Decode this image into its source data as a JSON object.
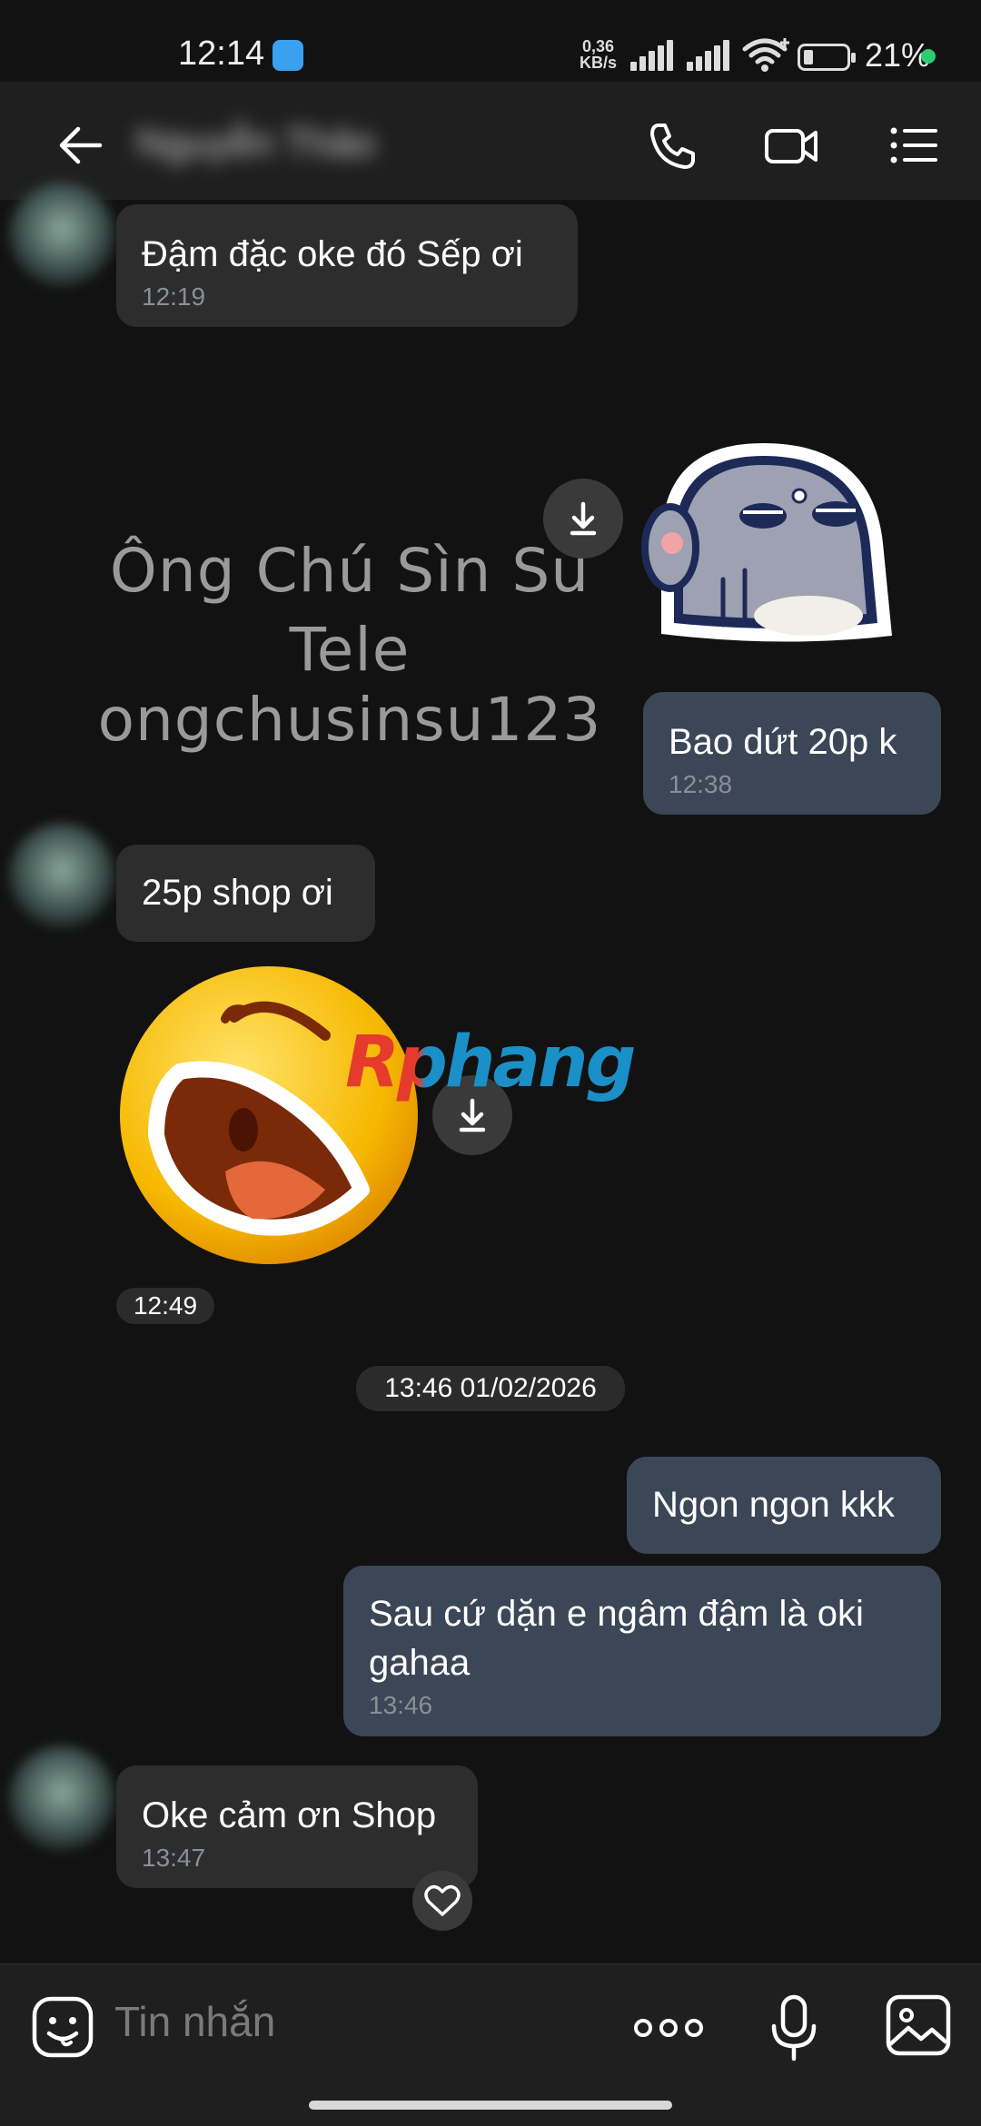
{
  "status_bar": {
    "time": "12:14",
    "net_speed_value": "0,36",
    "net_speed_unit": "KB/s",
    "battery_percent": "21%",
    "indicator_color": "#2ecc71"
  },
  "header": {
    "contact_name": "Nguyễn Thảo",
    "icons": [
      "back-arrow-icon",
      "phone-icon",
      "video-icon",
      "menu-list-icon"
    ]
  },
  "messages": [
    {
      "direction": "in",
      "text": "Đậm đặc oke đó Sếp ơi",
      "time": "12:19"
    },
    {
      "direction": "out",
      "type": "sticker",
      "sticker": "grey-ghost-sticker"
    },
    {
      "direction": "out",
      "text": "Bao dứt 20p k",
      "time": "12:38"
    },
    {
      "direction": "in",
      "text": "25p shop ơi"
    },
    {
      "direction": "in",
      "type": "sticker",
      "sticker": "laughing-emoji-sticker",
      "time": "12:49"
    },
    {
      "direction": "out",
      "text": "Ngon ngon kkk"
    },
    {
      "direction": "out",
      "text": "Sau cứ dặn e ngâm đậm là oki gahaa",
      "time": "13:46"
    },
    {
      "direction": "in",
      "text": "Oke cảm ơn Shop",
      "time": "13:47"
    }
  ],
  "date_separator": "13:46 01/02/2026",
  "watermark": {
    "line1": "Ông Chú Sìn Sú",
    "line2": "Tele ongchusinsu123"
  },
  "brand_overlay": "Rphang",
  "input": {
    "placeholder": "Tin nhắn",
    "icons": [
      "sticker-face-icon",
      "more-dots-icon",
      "microphone-icon",
      "image-gallery-icon"
    ]
  },
  "colors": {
    "incoming_bubble": "#2d2d2d",
    "outgoing_bubble": "#3b4656",
    "background": "#121212"
  }
}
